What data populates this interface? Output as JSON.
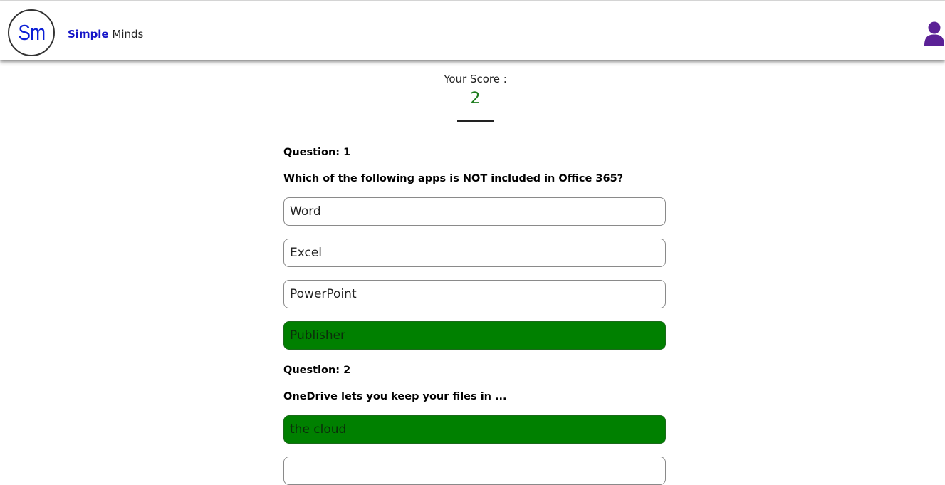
{
  "brand": {
    "logo_text": "Sm",
    "name_bold": "Simple",
    "name_light": "Minds"
  },
  "header": {
    "user_icon": "user-icon"
  },
  "score": {
    "label": "Your Score :",
    "value": "2"
  },
  "questions": [
    {
      "number_label": "Question: 1",
      "text": "Which of the following apps is NOT included in Office 365?",
      "options": [
        {
          "label": "Word",
          "selected": false
        },
        {
          "label": "Excel",
          "selected": false
        },
        {
          "label": "PowerPoint",
          "selected": false
        },
        {
          "label": "Publisher",
          "selected": true
        }
      ]
    },
    {
      "number_label": "Question: 2",
      "text": "OneDrive lets you keep your files in ...",
      "options": [
        {
          "label": "the cloud",
          "selected": true
        }
      ]
    }
  ],
  "colors": {
    "brand_blue": "#1414c8",
    "score_green": "#1d7c1d",
    "correct_green": "#008000",
    "user_icon_purple": "#5b2196"
  }
}
